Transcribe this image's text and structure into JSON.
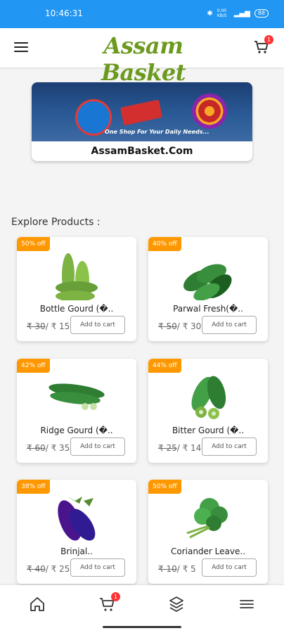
{
  "status_bar": {
    "time": "10:46:31",
    "net_speed": "0.00 KB/S",
    "battery": "88"
  },
  "header": {
    "logo_text": "Assam Basket",
    "cart_count": "1"
  },
  "banner": {
    "tagline": "One Shop For Your Daily Needs...",
    "site": "AssamBasket.Com"
  },
  "section_title": "Explore Products :",
  "colors": {
    "status_bar": "#2196f3",
    "logo_green": "#6b9a1e",
    "discount_badge": "#ff9800",
    "cart_badge": "#ff3333"
  },
  "products": [
    {
      "discount": "50% off",
      "name": "Bottle Gourd (�..",
      "old_price": "₹ 30",
      "new_price": "/ ₹ 15",
      "button": "Add to cart",
      "icon": "bottle-gourd"
    },
    {
      "discount": "40% off",
      "name": "Parwal Fresh(�..",
      "old_price": "₹ 50",
      "new_price": "/ ₹ 30",
      "button": "Add to cart",
      "icon": "parwal"
    },
    {
      "discount": "42% off",
      "name": "Ridge Gourd (�..",
      "old_price": "₹ 60",
      "new_price": "/ ₹ 35",
      "button": "Add to cart",
      "icon": "ridge-gourd"
    },
    {
      "discount": "44% off",
      "name": "Bitter Gourd (�..",
      "old_price": "₹ 25",
      "new_price": "/ ₹ 14",
      "button": "Add to cart",
      "icon": "bitter-gourd"
    },
    {
      "discount": "38% off",
      "name": "Brinjal..",
      "old_price": "₹ 40",
      "new_price": "/ ₹ 25",
      "button": "Add to cart",
      "icon": "brinjal"
    },
    {
      "discount": "50% off",
      "name": "Coriander Leave..",
      "old_price": "₹ 10",
      "new_price": "/ ₹ 5",
      "button": "Add to cart",
      "icon": "coriander"
    }
  ],
  "bottom_nav": [
    {
      "icon": "home-icon"
    },
    {
      "icon": "cart-icon",
      "badge": "1"
    },
    {
      "icon": "layers-icon"
    },
    {
      "icon": "menu-icon"
    }
  ]
}
